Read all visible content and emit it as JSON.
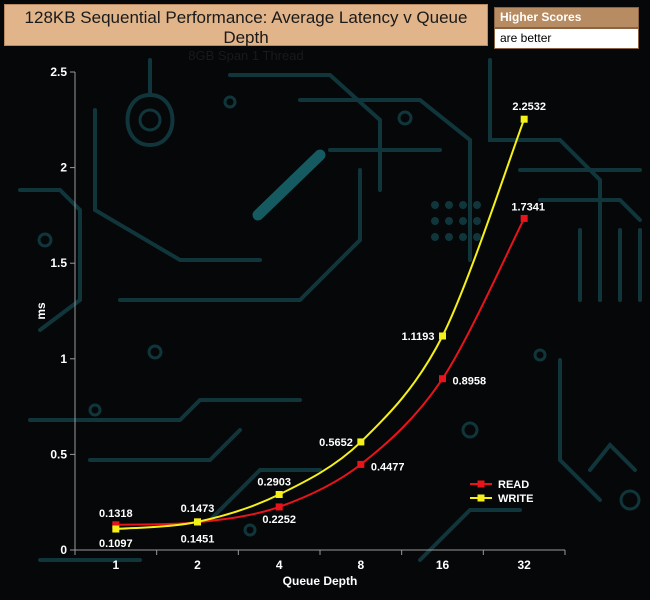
{
  "header": {
    "title": "128KB Sequential Performance: Average Latency v Queue Depth",
    "subtitle": "8GB Span 1 Thread"
  },
  "note": {
    "line1": "Higher Scores",
    "line2": "are better"
  },
  "chart_data": {
    "type": "line",
    "title": "128KB Sequential Performance: Average Latency v Queue Depth",
    "subtitle": "8GB Span 1 Thread",
    "xlabel": "Queue Depth",
    "ylabel": "ms",
    "categories": [
      "1",
      "2",
      "4",
      "8",
      "16",
      "32"
    ],
    "ylim": [
      0,
      2.5
    ],
    "yticks": [
      "0",
      "0.5",
      "1",
      "1.5",
      "2",
      "2.5"
    ],
    "grid": false,
    "legend_position": "bottom-right",
    "series": [
      {
        "name": "READ",
        "color": "#e8141a",
        "values": [
          0.1318,
          0.1451,
          0.2252,
          0.4477,
          0.8958,
          1.7341
        ],
        "labels": [
          "0.1318",
          "0.1451",
          "0.2252",
          "0.4477",
          "0.8958",
          "1.7341"
        ]
      },
      {
        "name": "WRITE",
        "color": "#f5f018",
        "values": [
          0.1097,
          0.1473,
          0.2903,
          0.5652,
          1.1193,
          2.2532
        ],
        "labels": [
          "0.1097",
          "0.1473",
          "0.2903",
          "0.5652",
          "1.1193",
          "2.2532"
        ]
      }
    ]
  }
}
